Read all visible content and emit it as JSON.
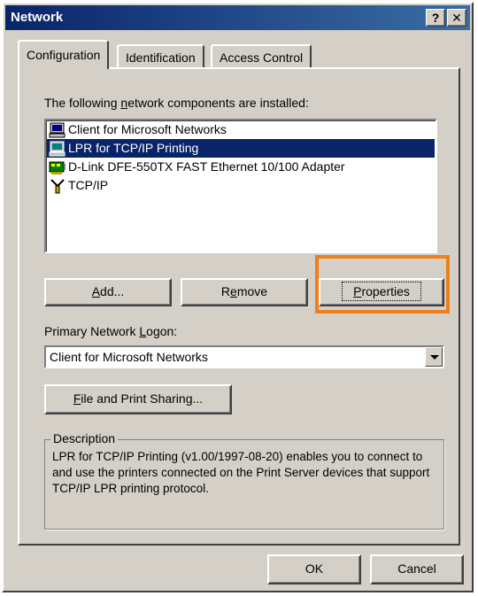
{
  "window": {
    "title": "Network",
    "help_label": "?",
    "close_label": "✕"
  },
  "tabs": [
    {
      "label": "Configuration",
      "active": true
    },
    {
      "label": "Identification",
      "active": false
    },
    {
      "label": "Access Control",
      "active": false
    }
  ],
  "components": {
    "label_pre": "The following ",
    "label_access": "n",
    "label_post": "etwork components are installed:",
    "items": [
      {
        "label": "Client for Microsoft Networks",
        "icon": "computer-icon",
        "selected": false
      },
      {
        "label": "LPR for TCP/IP Printing",
        "icon": "computer-icon",
        "selected": true
      },
      {
        "label": "D-Link DFE-550TX FAST Ethernet 10/100 Adapter",
        "icon": "network-adapter-icon",
        "selected": false
      },
      {
        "label": "TCP/IP",
        "icon": "protocol-icon",
        "selected": false
      }
    ]
  },
  "buttons": {
    "add_access": "A",
    "add_rest": "dd...",
    "remove_pre": "R",
    "remove_access": "e",
    "remove_rest": "move",
    "properties_access": "P",
    "properties_rest": "roperties",
    "file_print_access": "F",
    "file_print_rest": "ile and Print Sharing...",
    "ok": "OK",
    "cancel": "Cancel"
  },
  "logon": {
    "label_pre": "Primary Network ",
    "label_access": "L",
    "label_post": "ogon:",
    "value": "Client for Microsoft Networks"
  },
  "description": {
    "legend": "Description",
    "text": "LPR for TCP/IP Printing (v1.00/1997-08-20) enables you to connect to and use the printers connected on the Print Server devices that support TCP/IP LPR printing protocol."
  },
  "colors": {
    "highlight": "#ef7f1a",
    "titlebar": "#0a246a",
    "selection": "#0a246a",
    "face": "#d4d0c8"
  }
}
